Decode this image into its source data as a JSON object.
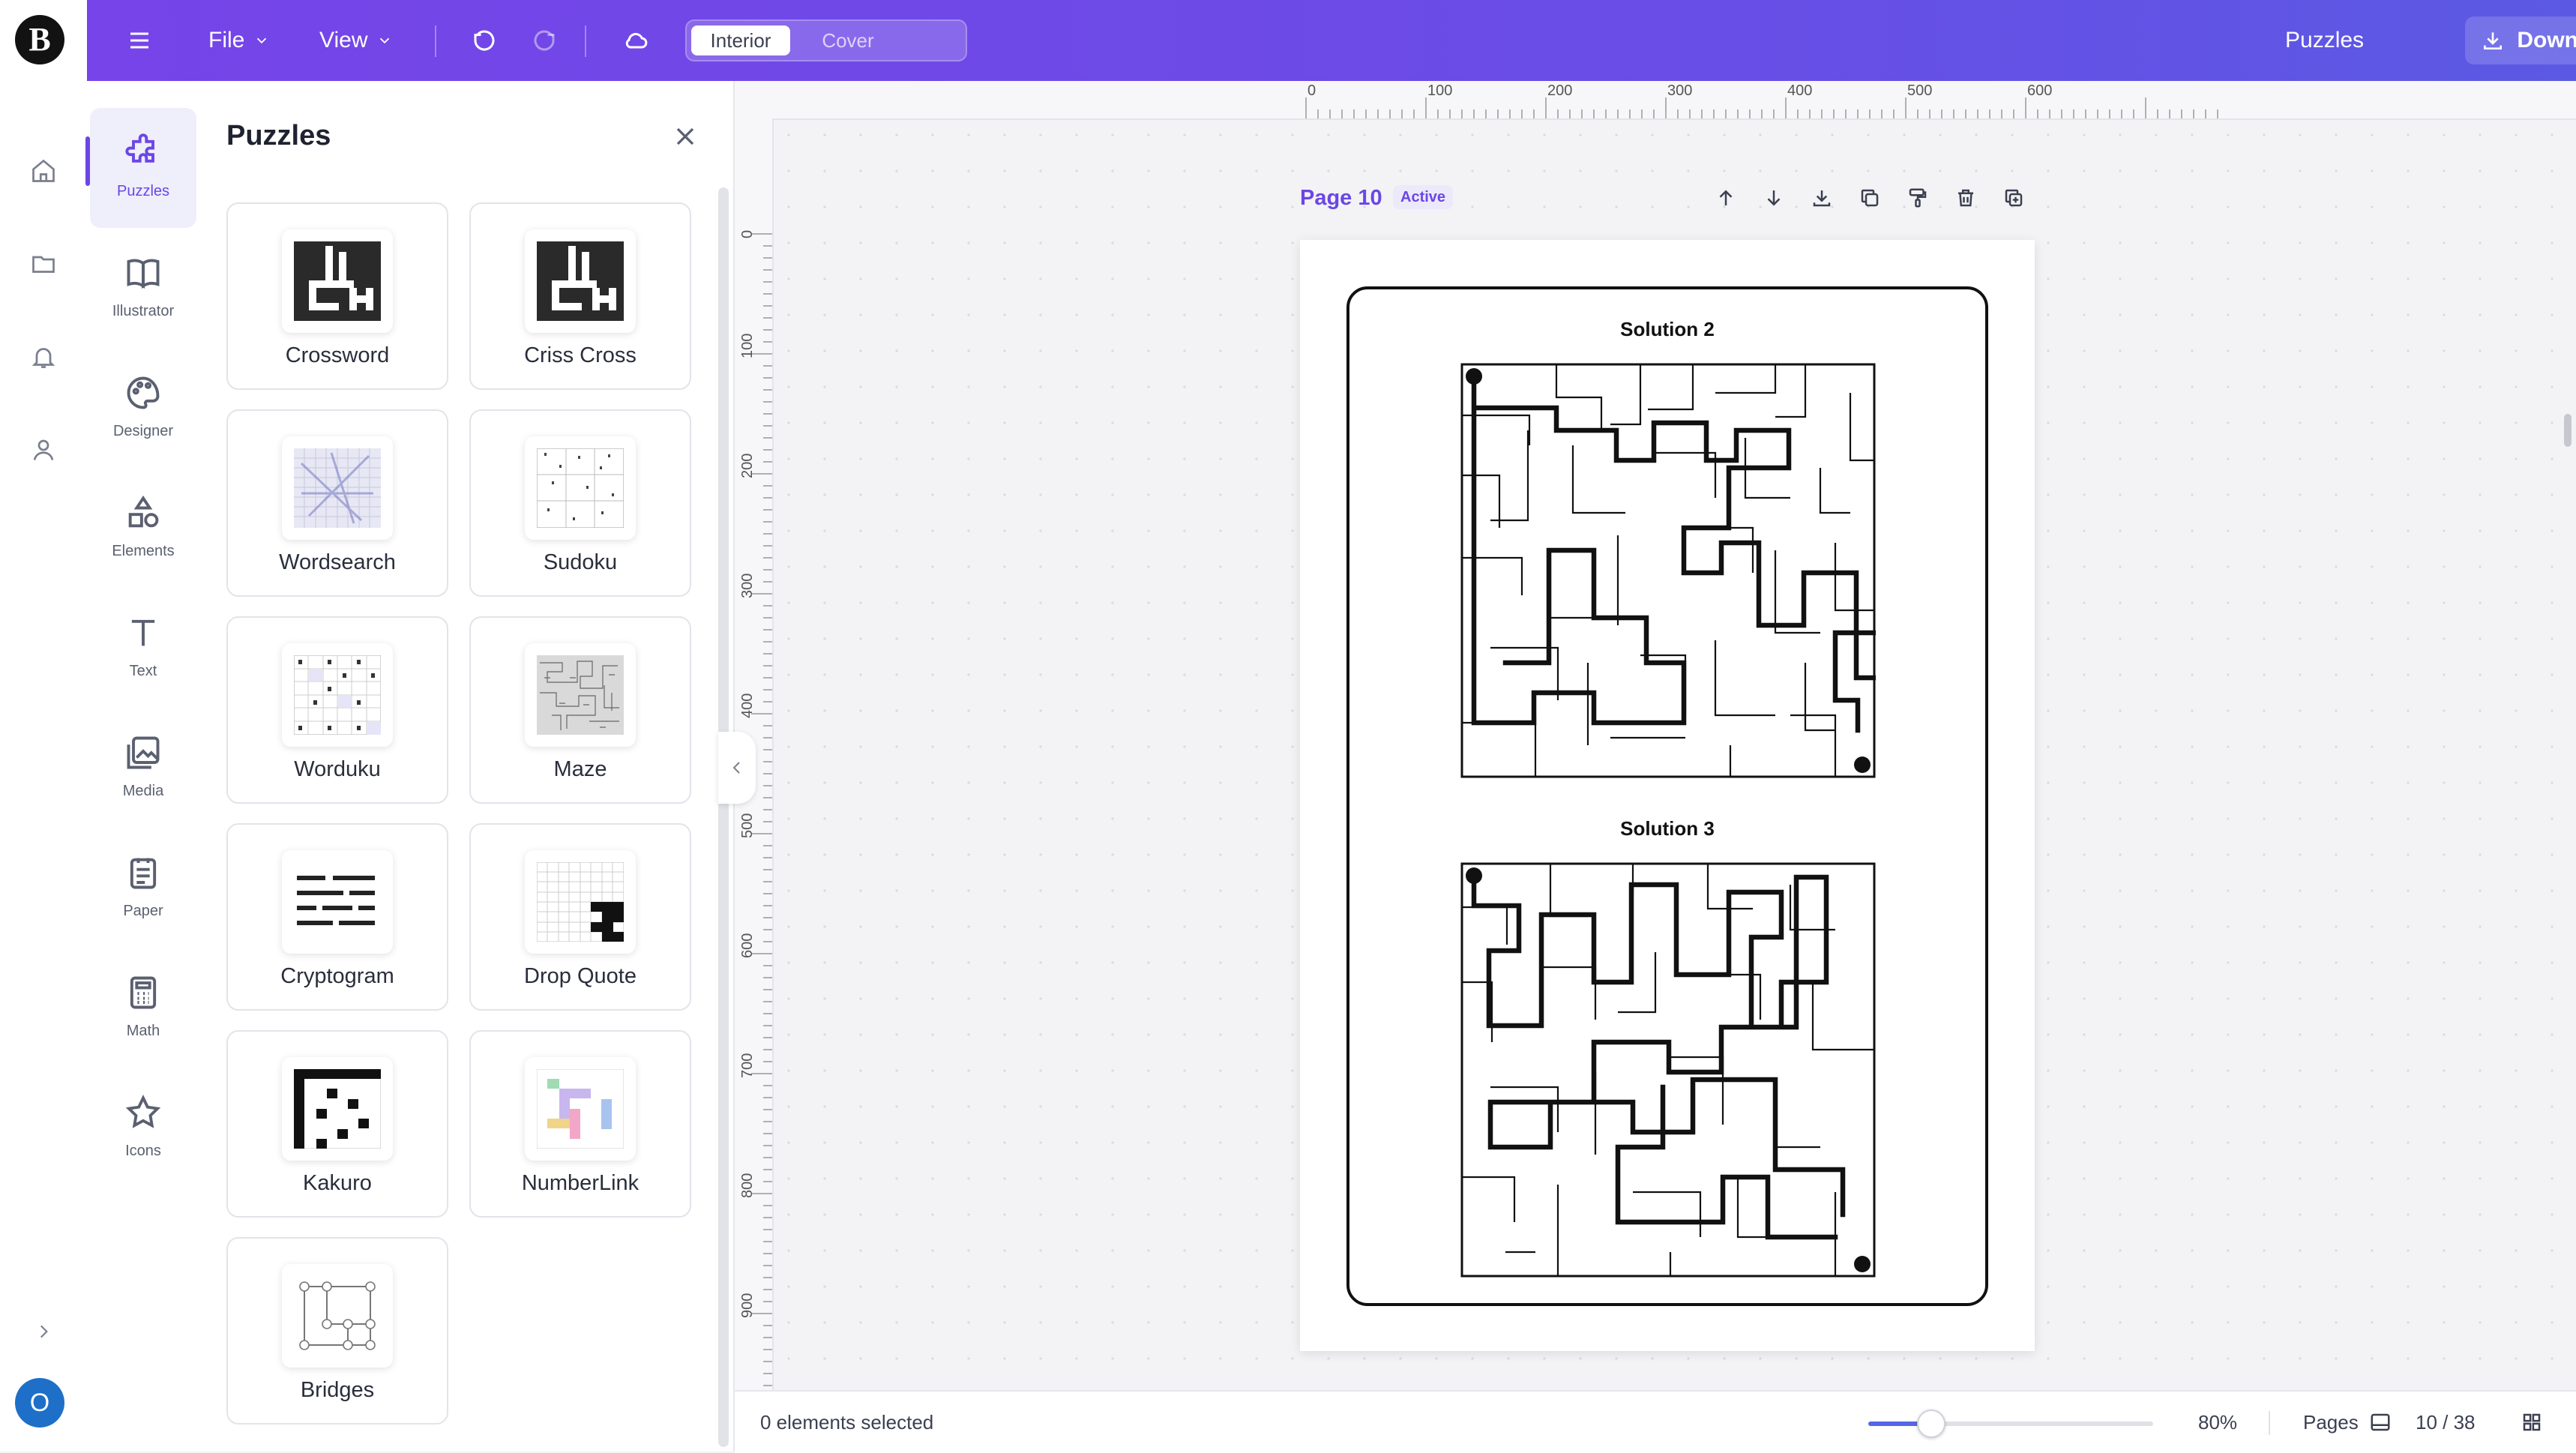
{
  "app": {
    "logo_text": "B",
    "avatar_initial": "O",
    "colors": {
      "accent": "#6b46e5",
      "topbar_start": "#7644e8",
      "topbar_end": "#5b59e4",
      "avatar": "#1e6fc8"
    }
  },
  "rail": {
    "icons": [
      "home-icon",
      "folder-icon",
      "bell-icon",
      "user-icon"
    ],
    "expand_icon": "chevron-right-icon"
  },
  "topbar": {
    "menu_icon": "hamburger-icon",
    "file_label": "File",
    "view_label": "View",
    "undo_icon": "undo-icon",
    "redo_icon": "redo-icon",
    "cloud_icon": "cloud-sync-icon",
    "modes": {
      "interior": "Interior",
      "cover": "Cover",
      "selected": "Interior"
    },
    "context_label": "Puzzles",
    "download_label": "Download"
  },
  "categories": {
    "selected": "Puzzles",
    "items": [
      {
        "label": "Puzzles",
        "icon": "puzzle-icon"
      },
      {
        "label": "Illustrator",
        "icon": "book-icon"
      },
      {
        "label": "Designer",
        "icon": "palette-icon"
      },
      {
        "label": "Elements",
        "icon": "shapes-icon"
      },
      {
        "label": "Text",
        "icon": "text-icon"
      },
      {
        "label": "Media",
        "icon": "image-icon"
      },
      {
        "label": "Paper",
        "icon": "paper-icon"
      },
      {
        "label": "Math",
        "icon": "calculator-icon"
      },
      {
        "label": "Icons",
        "icon": "star-icon"
      }
    ]
  },
  "panel": {
    "title": "Puzzles",
    "puzzles": [
      {
        "label": "Crossword"
      },
      {
        "label": "Criss Cross"
      },
      {
        "label": "Wordsearch"
      },
      {
        "label": "Sudoku"
      },
      {
        "label": "Worduku"
      },
      {
        "label": "Maze"
      },
      {
        "label": "Cryptogram"
      },
      {
        "label": "Drop Quote"
      },
      {
        "label": "Kakuro"
      },
      {
        "label": "NumberLink"
      },
      {
        "label": "Bridges"
      }
    ]
  },
  "rulers": {
    "top": [
      "0",
      "100",
      "200",
      "300",
      "400",
      "500",
      "600"
    ],
    "left": [
      "0",
      "100",
      "200",
      "300",
      "400",
      "500",
      "600",
      "700",
      "800",
      "900"
    ]
  },
  "page": {
    "label": "Page 10",
    "badge": "Active",
    "tools": [
      "move-up-icon",
      "move-down-icon",
      "download-icon",
      "copy-icon",
      "format-paint-icon",
      "trash-icon",
      "add-page-icon"
    ],
    "solutions": [
      {
        "title": "Solution 2"
      },
      {
        "title": "Solution 3"
      }
    ]
  },
  "status": {
    "selection": "0 elements selected",
    "zoom": "80%",
    "zoom_fraction": 0.22,
    "pages_label": "Pages",
    "page_count": "10 / 38"
  }
}
